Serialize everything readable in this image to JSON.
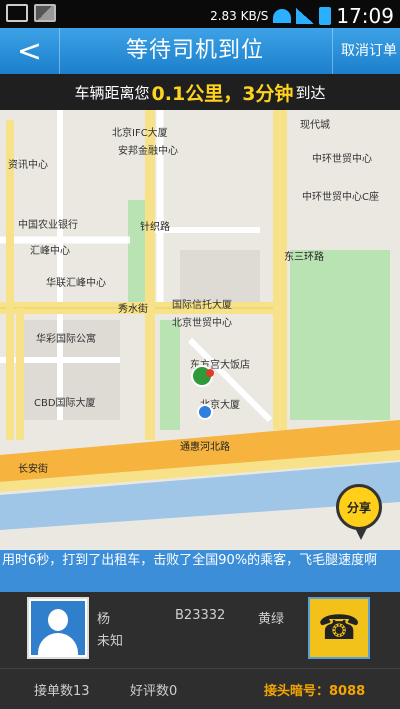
{
  "status_bar": {
    "speed": "2.83 KB/S",
    "time": "17:09"
  },
  "title_bar": {
    "back_symbol": "<",
    "title": "等待司机到位",
    "cancel_label": "取消订单"
  },
  "info_bar": {
    "prefix": "车辆距离您",
    "distance": "0.1公里，3分钟",
    "suffix": "到达"
  },
  "map": {
    "pois": [
      "北京IFC大厦",
      "安邦金融中心",
      "现代城",
      "资讯中心",
      "中环世贸中心",
      "中环世贸中心C座",
      "中国农业银行",
      "汇峰中心",
      "华联汇峰中心",
      "国际信托大厦",
      "北京世贸中心",
      "华彩国际公寓",
      "东方宫大饭店",
      "CBD国际大厦",
      "北京大厦"
    ],
    "roads": [
      "秀水街",
      "长安街",
      "通惠河北路",
      "东三环路",
      "针织路"
    ],
    "share_label": "分享"
  },
  "ticker": {
    "text": "用时6秒，打到了出租车，击败了全国90%的乘客，飞毛腿速度啊"
  },
  "driver": {
    "name": "杨",
    "status": "未知",
    "plate": "B23332",
    "color": "黄绿",
    "orders_label": "接单数13",
    "rating_label": "好评数0",
    "pickup_code": "接头暗号：8088"
  }
}
